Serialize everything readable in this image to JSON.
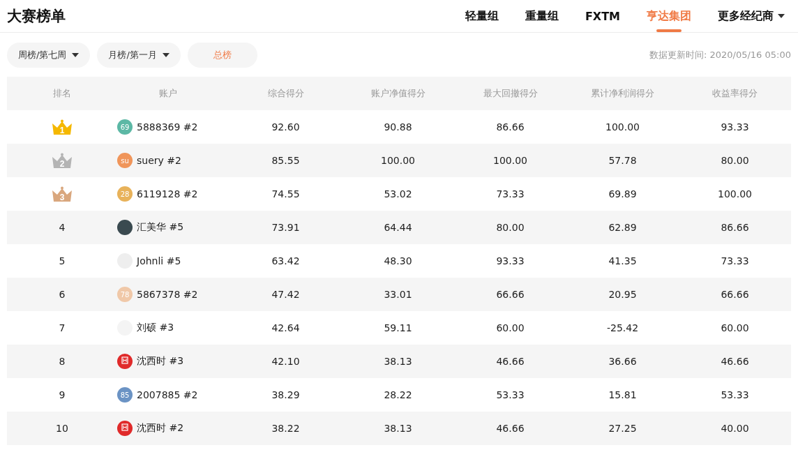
{
  "title": "大赛榜单",
  "tabs": [
    {
      "label": "轻量组",
      "selected": false
    },
    {
      "label": "重量组",
      "selected": false
    },
    {
      "label": "FXTM",
      "selected": false
    },
    {
      "label": "亨达集团",
      "selected": true
    },
    {
      "label": "更多经纪商",
      "selected": false,
      "dropdown": true
    }
  ],
  "filters": [
    {
      "label": "周榜/第七周",
      "dropdown": true,
      "selected": false
    },
    {
      "label": "月榜/第一月",
      "dropdown": true,
      "selected": false
    },
    {
      "label": "总榜",
      "dropdown": false,
      "selected": true
    }
  ],
  "update_time": "数据更新时间: 2020/05/16 05:00",
  "table": {
    "columns": [
      "排名",
      "账户",
      "综合得分",
      "账户净值得分",
      "最大回撤得分",
      "累计净利润得分",
      "收益率得分"
    ],
    "rows": [
      {
        "rank": "1",
        "kind": "crown",
        "color": "#f5b800",
        "avatar": {
          "kind": "initials",
          "text": "69",
          "color": "#5cb8a5"
        },
        "account": "5888369 #2",
        "scores": [
          "92.60",
          "90.88",
          "86.66",
          "100.00",
          "93.33"
        ]
      },
      {
        "rank": "2",
        "kind": "crown",
        "color": "#b4b4b4",
        "avatar": {
          "kind": "initials",
          "text": "su",
          "color": "#f0955a"
        },
        "account": "suery #2",
        "scores": [
          "85.55",
          "100.00",
          "100.00",
          "57.78",
          "80.00"
        ]
      },
      {
        "rank": "3",
        "kind": "crown",
        "color": "#d9a77e",
        "avatar": {
          "kind": "initials",
          "text": "28",
          "color": "#e8b25a"
        },
        "account": "6119128 #2",
        "scores": [
          "74.55",
          "53.02",
          "73.33",
          "69.89",
          "100.00"
        ]
      },
      {
        "rank": "4",
        "kind": "plain",
        "avatar": {
          "kind": "photo",
          "color": "#3a4a50"
        },
        "account": "汇美华 #5",
        "scores": [
          "73.91",
          "64.44",
          "80.00",
          "62.89",
          "86.66"
        ]
      },
      {
        "rank": "5",
        "kind": "plain",
        "avatar": {
          "kind": "photo",
          "color": "#eeeeee"
        },
        "account": "Johnli #5",
        "scores": [
          "63.42",
          "48.30",
          "93.33",
          "41.35",
          "73.33"
        ]
      },
      {
        "rank": "6",
        "kind": "plain",
        "avatar": {
          "kind": "initials",
          "text": "78",
          "color": "#f0c8a8"
        },
        "account": "5867378 #2",
        "scores": [
          "47.42",
          "33.01",
          "66.66",
          "20.95",
          "66.66"
        ]
      },
      {
        "rank": "7",
        "kind": "plain",
        "avatar": {
          "kind": "photo",
          "color": "#f4f4f4"
        },
        "account": "刘硕 #3",
        "scores": [
          "42.64",
          "59.11",
          "60.00",
          "-25.42",
          "60.00"
        ]
      },
      {
        "rank": "8",
        "kind": "plain",
        "avatar": {
          "kind": "logo",
          "color": "#e02a2a"
        },
        "account": "沈西时 #3",
        "scores": [
          "42.10",
          "38.13",
          "46.66",
          "36.66",
          "46.66"
        ]
      },
      {
        "rank": "9",
        "kind": "plain",
        "avatar": {
          "kind": "initials",
          "text": "85",
          "color": "#6b93c4"
        },
        "account": "2007885 #2",
        "scores": [
          "38.29",
          "28.22",
          "53.33",
          "15.81",
          "53.33"
        ]
      },
      {
        "rank": "10",
        "kind": "plain",
        "avatar": {
          "kind": "logo",
          "color": "#e02a2a"
        },
        "account": "沈西时 #2",
        "scores": [
          "38.22",
          "38.13",
          "46.66",
          "27.25",
          "40.00"
        ]
      }
    ]
  }
}
